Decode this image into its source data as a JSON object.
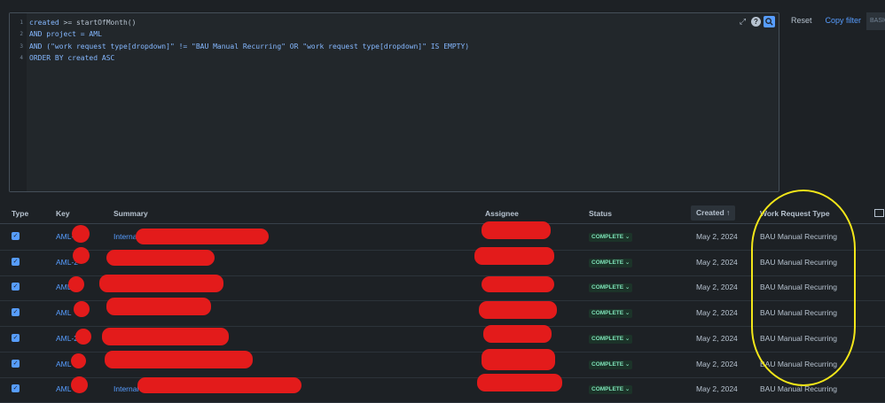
{
  "editor": {
    "lines": [
      {
        "num": "1",
        "parts": [
          {
            "t": "created",
            "c": "kw"
          },
          {
            "t": " >= startOfMonth()",
            "c": "fn"
          }
        ]
      },
      {
        "num": "2",
        "parts": [
          {
            "t": "AND project = AML",
            "c": "kw"
          }
        ]
      },
      {
        "num": "3",
        "parts": [
          {
            "t": "AND (\"work request type[dropdown]\" != \"BAU Manual Recurring\" OR \"work request type[dropdown]\" IS EMPTY)",
            "c": "kw"
          }
        ]
      },
      {
        "num": "4",
        "parts": [
          {
            "t": "ORDER BY created ASC",
            "c": "kw"
          }
        ]
      }
    ],
    "help_label": "?"
  },
  "actions": {
    "reset_label": "Reset",
    "copy_filter_label": "Copy filter",
    "basic_label": "BASIC"
  },
  "columns": {
    "type": "Type",
    "key": "Key",
    "summary": "Summary",
    "assignee": "Assignee",
    "status": "Status",
    "created": "Created ↑",
    "work_request_type": "Work Request Type"
  },
  "rows": [
    {
      "key": "AML-2",
      "summary": "Interna",
      "status": "COMPLETE ⌄",
      "created": "May 2, 2024",
      "wrt": "BAU Manual Recurring"
    },
    {
      "key": "AML-2",
      "summary": "",
      "status": "COMPLETE ⌄",
      "created": "May 2, 2024",
      "wrt": "BAU Manual Recurring"
    },
    {
      "key": "AML",
      "summary": "",
      "status": "COMPLETE ⌄",
      "created": "May 2, 2024",
      "wrt": "BAU Manual Recurring"
    },
    {
      "key": "AML",
      "summary": "",
      "status": "COMPLETE ⌄",
      "created": "May 2, 2024",
      "wrt": "BAU Manual Recurring"
    },
    {
      "key": "AML-2",
      "summary": "",
      "status": "COMPLETE ⌄",
      "created": "May 2, 2024",
      "wrt": "BAU Manual Recurring"
    },
    {
      "key": "AML",
      "summary": "",
      "status": "COMPLETE ⌄",
      "created": "May 2, 2024",
      "wrt": "BAU Manual Recurring"
    },
    {
      "key": "AML",
      "summary": "Internal",
      "status": "COMPLETE ⌄",
      "created": "May 2, 2024",
      "wrt": "BAU Manual Recurring"
    }
  ],
  "colors": {
    "background": "#1d2125",
    "link": "#579dff",
    "status_bg": "#1c3329",
    "status_text": "#7ee2b8",
    "redaction": "#e31b1b",
    "highlight": "#f2e619"
  },
  "icons": {
    "expand": "expand-icon",
    "help": "help-icon",
    "search": "search-icon",
    "checkbox": "checkbox-icon",
    "column_view": "column-view-icon"
  }
}
